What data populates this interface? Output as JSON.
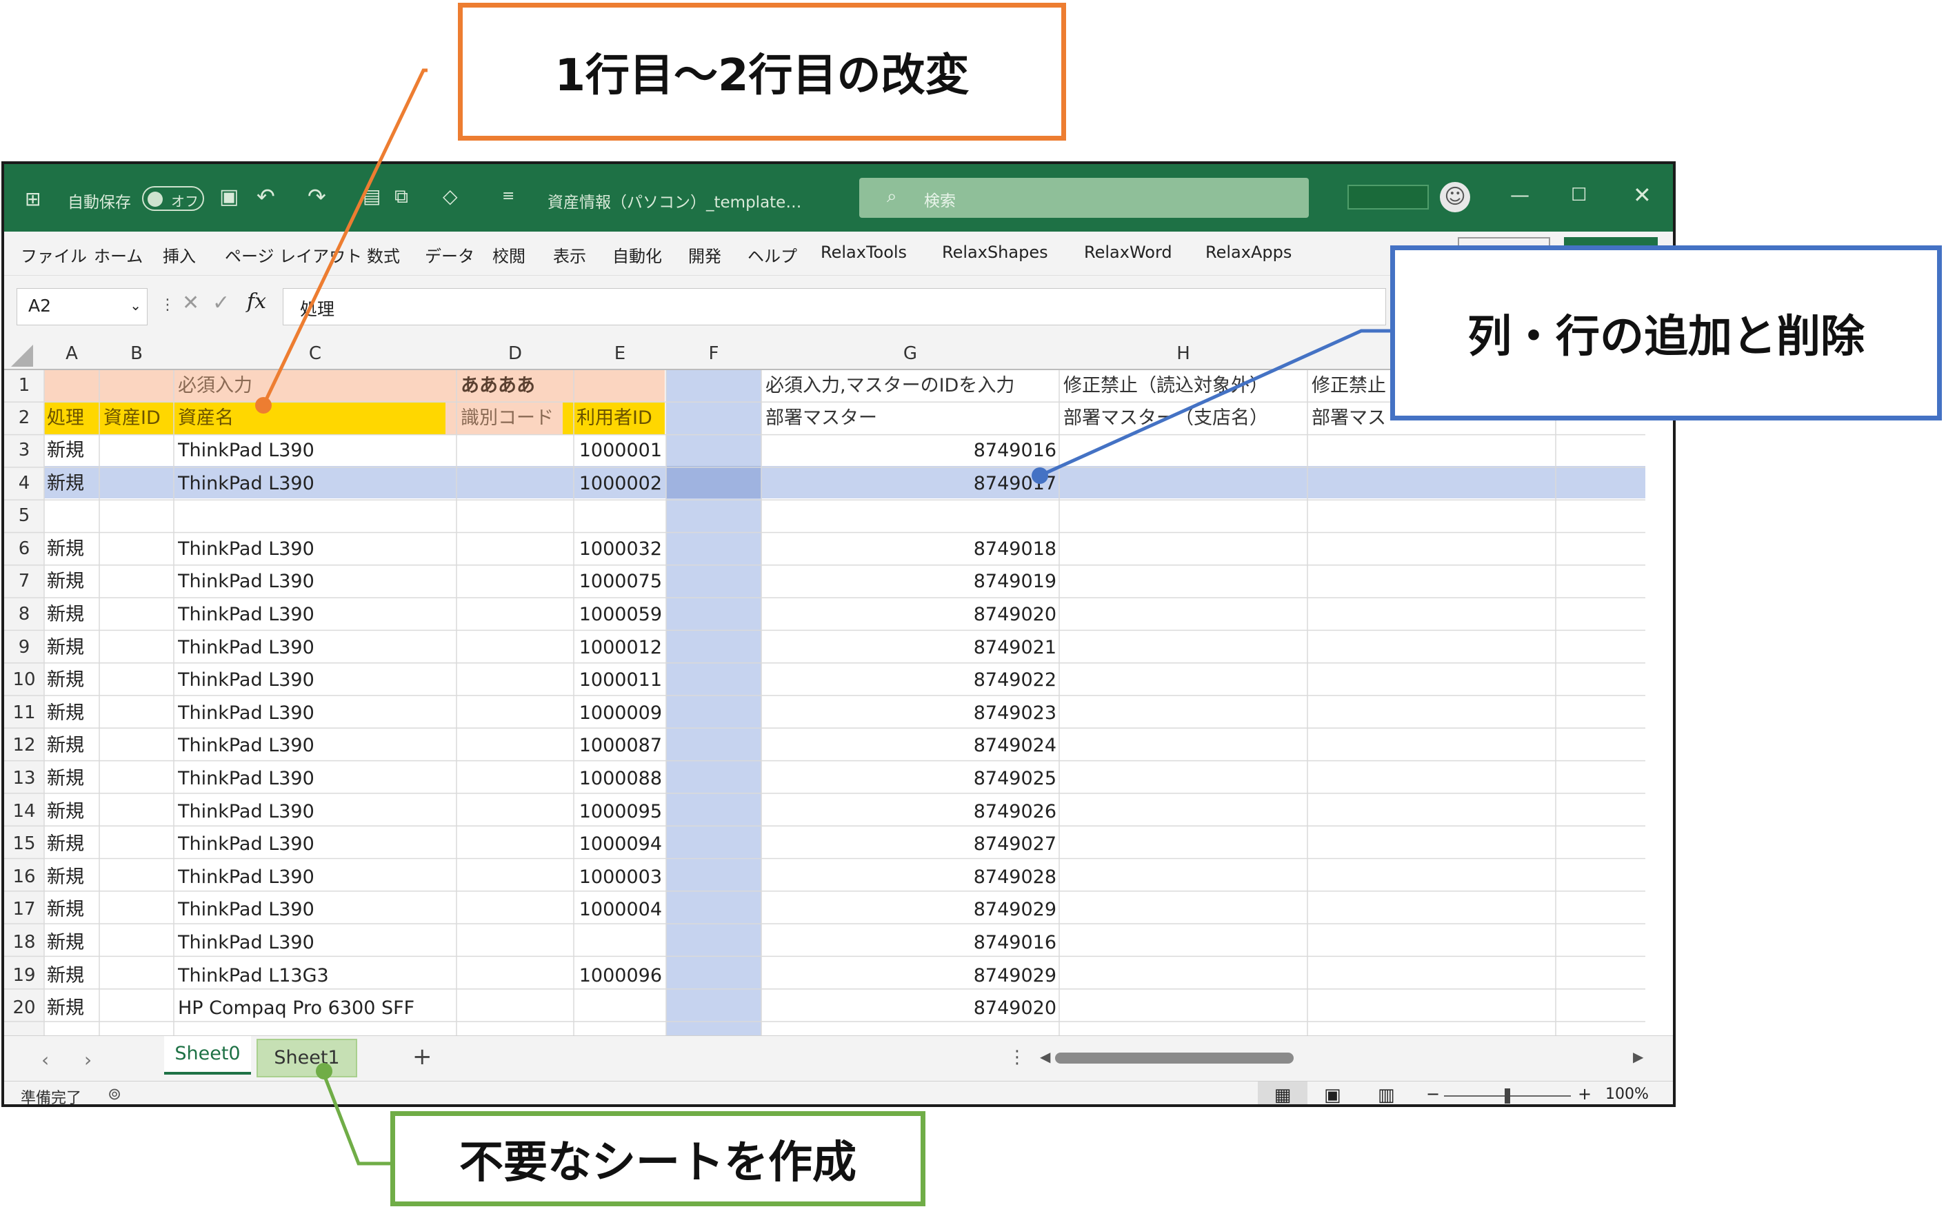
{
  "window": {
    "autosave_label": "自動保存",
    "autosave_state": "オフ",
    "title": "資産情報（パソコン）_template…",
    "search_placeholder": "検索"
  },
  "ribbon": [
    "ファイル",
    "ホーム",
    "挿入",
    "ページ レイアウト",
    "数式",
    "データ",
    "校閲",
    "表示",
    "自動化",
    "開発",
    "ヘルプ",
    "RelaxTools",
    "RelaxShapes",
    "RelaxWord",
    "RelaxApps"
  ],
  "formula_bar": {
    "name_box": "A2",
    "fx": "fx",
    "content": "処理"
  },
  "columns": [
    "A",
    "B",
    "C",
    "D",
    "E",
    "F",
    "G",
    "H"
  ],
  "header_rows": {
    "row1": {
      "C": "必須入力",
      "D": "ああああ",
      "G": "必須入力,マスターのIDを入力",
      "H": "修正禁止（読込対象外）",
      "I": "修正禁止"
    },
    "row2": {
      "A": "処理",
      "B": "資産ID",
      "C": "資産名",
      "D": "識別コード",
      "E": "利用者ID",
      "G": "部署マスター",
      "H": "部署マスター（支店名）",
      "I": "部署マス"
    }
  },
  "rows": [
    {
      "n": "3",
      "a": "新規",
      "c": "ThinkPad L390",
      "e": "1000001",
      "g": "8749016"
    },
    {
      "n": "4",
      "a": "新規",
      "c": "ThinkPad L390",
      "e": "1000002",
      "g": "8749017"
    },
    {
      "n": "5",
      "a": "",
      "c": "",
      "e": "",
      "g": ""
    },
    {
      "n": "6",
      "a": "新規",
      "c": "ThinkPad L390",
      "e": "1000032",
      "g": "8749018"
    },
    {
      "n": "7",
      "a": "新規",
      "c": "ThinkPad L390",
      "e": "1000075",
      "g": "8749019"
    },
    {
      "n": "8",
      "a": "新規",
      "c": "ThinkPad L390",
      "e": "1000059",
      "g": "8749020"
    },
    {
      "n": "9",
      "a": "新規",
      "c": "ThinkPad L390",
      "e": "1000012",
      "g": "8749021"
    },
    {
      "n": "10",
      "a": "新規",
      "c": "ThinkPad L390",
      "e": "1000011",
      "g": "8749022"
    },
    {
      "n": "11",
      "a": "新規",
      "c": "ThinkPad L390",
      "e": "1000009",
      "g": "8749023"
    },
    {
      "n": "12",
      "a": "新規",
      "c": "ThinkPad L390",
      "e": "1000087",
      "g": "8749024"
    },
    {
      "n": "13",
      "a": "新規",
      "c": "ThinkPad L390",
      "e": "1000088",
      "g": "8749025"
    },
    {
      "n": "14",
      "a": "新規",
      "c": "ThinkPad L390",
      "e": "1000095",
      "g": "8749026"
    },
    {
      "n": "15",
      "a": "新規",
      "c": "ThinkPad L390",
      "e": "1000094",
      "g": "8749027"
    },
    {
      "n": "16",
      "a": "新規",
      "c": "ThinkPad L390",
      "e": "1000003",
      "g": "8749028"
    },
    {
      "n": "17",
      "a": "新規",
      "c": "ThinkPad L390",
      "e": "1000004",
      "g": "8749029"
    },
    {
      "n": "18",
      "a": "新規",
      "c": "ThinkPad L390",
      "e": "",
      "g": "8749016"
    },
    {
      "n": "19",
      "a": "新規",
      "c": "ThinkPad L13G3",
      "e": "1000096",
      "g": "8749029"
    },
    {
      "n": "20",
      "a": "新規",
      "c": "HP Compaq Pro 6300 SFF",
      "e": "",
      "g": "8749020"
    }
  ],
  "sheets": {
    "tab0": "Sheet0",
    "tab1": "Sheet1",
    "add": "+"
  },
  "status": {
    "ready": "準備完了",
    "zoom": "100%"
  },
  "callouts": {
    "top": "1行目～2行目の改変",
    "right": "列・行の追加と削除",
    "bottom": "不要なシートを作成"
  },
  "colors": {
    "excel_green": "#1e7145",
    "header_peach": "#fbd5c0",
    "header_yellow": "#ffd700",
    "highlight_blue": "#c6d3ef",
    "orange": "#ed7d31",
    "blue": "#4472c4",
    "green": "#70ad47"
  }
}
